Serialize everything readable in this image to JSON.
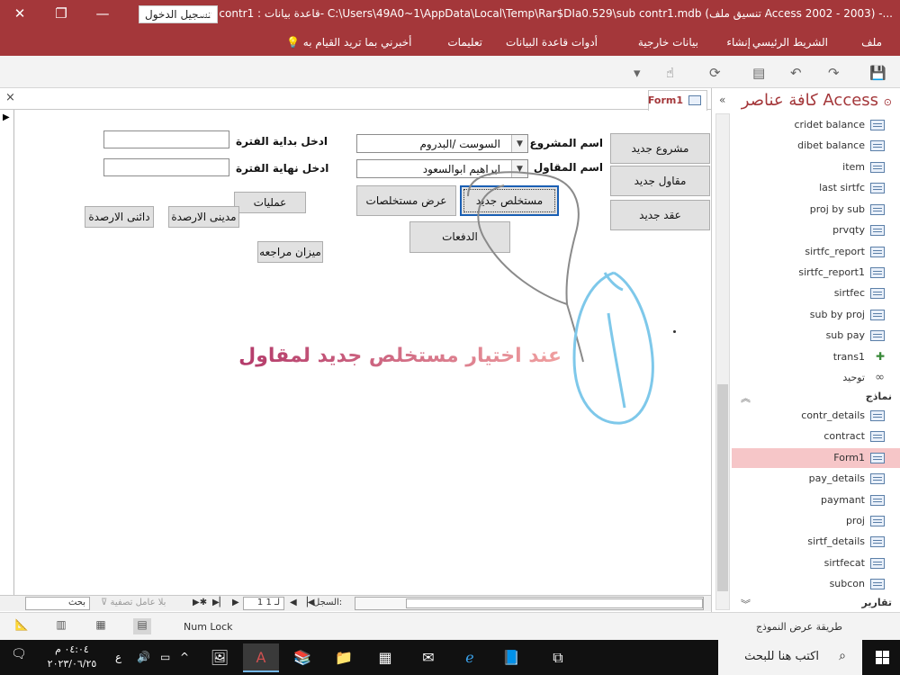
{
  "window": {
    "title": "sub contr1 : قاعدة بيانات- C:\\Users\\49A0~1\\AppData\\Local\\Temp\\Rar$DIa0.529\\sub contr1.mdb (تنسيق ملف Access 2002 - 2003) -...",
    "signin_label": "تسجيل الدخول",
    "close_glyph": "✕",
    "restore_glyph": "❐",
    "minimize_glyph": "—"
  },
  "menu": {
    "items": [
      "ملف",
      "الشريط الرئيسي",
      "إنشاء",
      "بيانات خارجية",
      "أدوات قاعدة البيانات",
      "تعليمات"
    ],
    "tell_me": "أخبرني بما تريد القيام به"
  },
  "nav": {
    "title": "كافة عناصر Access",
    "collapse_glyph": "«",
    "items_top": [
      "cridet balance",
      "dibet balance",
      "item",
      "last sirtfc",
      "proj by sub",
      "prvqty",
      "sirtfc_report",
      "sirtfc_report1",
      "sirtfec",
      "sub by proj",
      "sub pay"
    ],
    "macro_item": "trans1",
    "relationship_item": "توحيد",
    "forms_group": "نماذج",
    "forms": [
      "contr_details",
      "contract",
      "Form1",
      "pay_details",
      "paymant",
      "proj",
      "sirtf_details",
      "sirtfecat",
      "subcon"
    ],
    "selected_form": "Form1",
    "reports_group": "تقارير"
  },
  "doc": {
    "tab_label": "Form1",
    "close_glyph": "×"
  },
  "form": {
    "buttons": {
      "new_project": "مشروع جديد",
      "new_contractor": "مقاول جديد",
      "new_contract": "عقد جديد",
      "new_statement": "مستخلص جديد",
      "view_statements": "عرض مستخلصات",
      "payments": "الدفعات",
      "operations": "عمليات",
      "debit_balances": "مدينى الارصدة",
      "credit_balances": "دائنى الارصدة",
      "trial_balance": "ميزان مراجعه"
    },
    "labels": {
      "project_name": "اسم المشروع",
      "contractor_name": "اسم المقاول",
      "period_start": "ادخل بداية الفترة",
      "period_end": "ادخل نهاية الفترة"
    },
    "combos": {
      "project_value": "السوست /البدروم",
      "contractor_value": "ابراهيم ابوالسعود"
    },
    "annotation_text": "عند اختيار مستخلص جديد لمقاول"
  },
  "recnav": {
    "record_label": "السجل:",
    "record_value": "1 لـ 1",
    "filter_label": "بلا عامل تصفية",
    "search_label": "بحث"
  },
  "status": {
    "view_name": "طريقة عرض النموذج",
    "numlock": "Num Lock"
  },
  "taskbar": {
    "search_text": "اكتب هنا للبحث",
    "time": "٠٤:٠٤ م",
    "date": "٢٠٢٣/٠٦/٢٥",
    "lang": "ع"
  },
  "colors": {
    "accent": "#a4373a",
    "selected_nav": "#f6c6c8",
    "annotation_gradient_start": "#f0a0a0",
    "annotation_gradient_end": "#b33a6a",
    "scribble_blue": "#7ec8ea",
    "scribble_gray": "#8a8a8a"
  }
}
